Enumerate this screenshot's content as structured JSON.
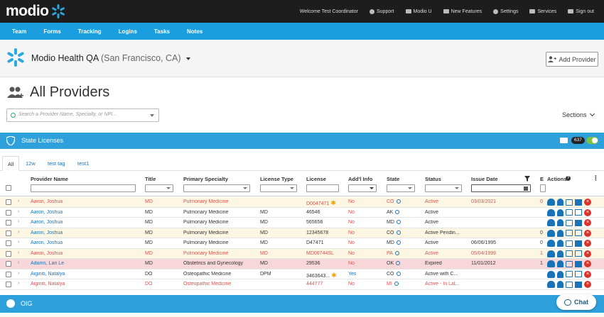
{
  "app": {
    "logo_text": "modio",
    "top_nav": [
      {
        "label": "Welcome Test Coordinator",
        "icon": ""
      },
      {
        "label": "Support",
        "icon": "support-icon"
      },
      {
        "label": "Modio U",
        "icon": "book-icon"
      },
      {
        "label": "New Features",
        "icon": "megaphone-icon"
      },
      {
        "label": "Settings",
        "icon": "gear-icon"
      },
      {
        "label": "Services",
        "icon": "services-icon"
      },
      {
        "label": "Sign out",
        "icon": "sign-out-icon"
      }
    ],
    "main_nav": [
      "Team",
      "Forms",
      "Tracking",
      "Logins",
      "Tasks",
      "Notes"
    ]
  },
  "org": {
    "name": "Modio Health QA",
    "location": "(San Francisco, CA)",
    "add_provider_label": "Add Provider"
  },
  "page": {
    "title": "All Providers",
    "search_placeholder": "Search a Provider Name, Specialty, or NPI...",
    "sections_label": "Sections"
  },
  "state_licenses": {
    "title": "State Licenses",
    "count": "637",
    "tabs": [
      "All",
      "12w",
      "test tag",
      "test1"
    ],
    "columns": [
      "Provider Name",
      "Title",
      "Primary Specialty",
      "License Type",
      "License",
      "Add'l Info",
      "State",
      "Status",
      "Issue Date",
      "E",
      "Actions"
    ],
    "rows": [
      {
        "name": "Aaron, Joshua",
        "title": "MD",
        "specialty": "Pulmonary Medicine",
        "license_type": "",
        "license": "D0047471",
        "addl": "No",
        "state": "CO",
        "status": "Active",
        "issue": "03/03/2021",
        "e": "0",
        "style": "yellow",
        "tone": "red",
        "star": true
      },
      {
        "name": "Aaron, Joshua",
        "title": "MD",
        "specialty": "Pulmonary Medicine",
        "license_type": "MD",
        "license": "46546",
        "addl": "No",
        "state": "AK",
        "status": "Active",
        "issue": "",
        "e": "",
        "style": "white",
        "tone": "normal",
        "star": false
      },
      {
        "name": "Aaron, Joshua",
        "title": "MD",
        "specialty": "Pulmonary Medicine",
        "license_type": "MD",
        "license": "565656",
        "addl": "No",
        "state": "MD",
        "status": "Active",
        "issue": "",
        "e": "",
        "style": "white",
        "tone": "normal",
        "star": false
      },
      {
        "name": "Aaron, Joshua",
        "title": "MD",
        "specialty": "Pulmonary Medicine",
        "license_type": "MD",
        "license": "12345678",
        "addl": "No",
        "state": "CO",
        "status": "Active Pendin...",
        "issue": "",
        "e": "0",
        "style": "yellow",
        "tone": "normal",
        "star": false
      },
      {
        "name": "Aaron, Joshua",
        "title": "MD",
        "specialty": "Pulmonary Medicine",
        "license_type": "MD",
        "license": "D47471",
        "addl": "No",
        "state": "MD",
        "status": "Active",
        "issue": "06/06/1995",
        "e": "0",
        "style": "white",
        "tone": "normal",
        "star": false
      },
      {
        "name": "Aaron, Joshua",
        "title": "MD",
        "specialty": "Pulmonary Medicine",
        "license_type": "MD",
        "license": "MD06744SL",
        "addl": "No",
        "state": "PA",
        "status": "Active",
        "issue": "05/04/1999",
        "e": "1",
        "style": "yellow",
        "tone": "red",
        "star": false
      },
      {
        "name": "Adams, Lan Le",
        "title": "MD",
        "specialty": "Obstetrics and Gynecology",
        "license_type": "MD",
        "license": "29536",
        "addl": "No",
        "state": "OK",
        "status": "Expired",
        "issue": "11/01/2012",
        "e": "1",
        "style": "red",
        "tone": "normal",
        "star": false
      },
      {
        "name": "Aiginiti, Natalya",
        "title": "DO",
        "specialty": "Osteopathic Medicine",
        "license_type": "DPM",
        "license": "3463643...",
        "addl": "Yes",
        "state": "CO",
        "status": "Active with C...",
        "issue": "",
        "e": "",
        "style": "white",
        "tone": "normal",
        "star": true
      },
      {
        "name": "Aiginiti, Natalya",
        "title": "DO",
        "specialty": "Osteopathic Medicine",
        "license_type": "",
        "license": "444777",
        "addl": "No",
        "state": "MI",
        "status": "Active - In Lat...",
        "issue": "",
        "e": "",
        "style": "white",
        "tone": "red",
        "star": false
      }
    ]
  },
  "oig": {
    "title": "OIG"
  },
  "chat": {
    "label": "Chat"
  },
  "colors": {
    "brand_blue": "#1a9ee0",
    "section_blue": "#2ea1dd",
    "dark": "#1d1d1d",
    "danger": "#d9342b"
  }
}
